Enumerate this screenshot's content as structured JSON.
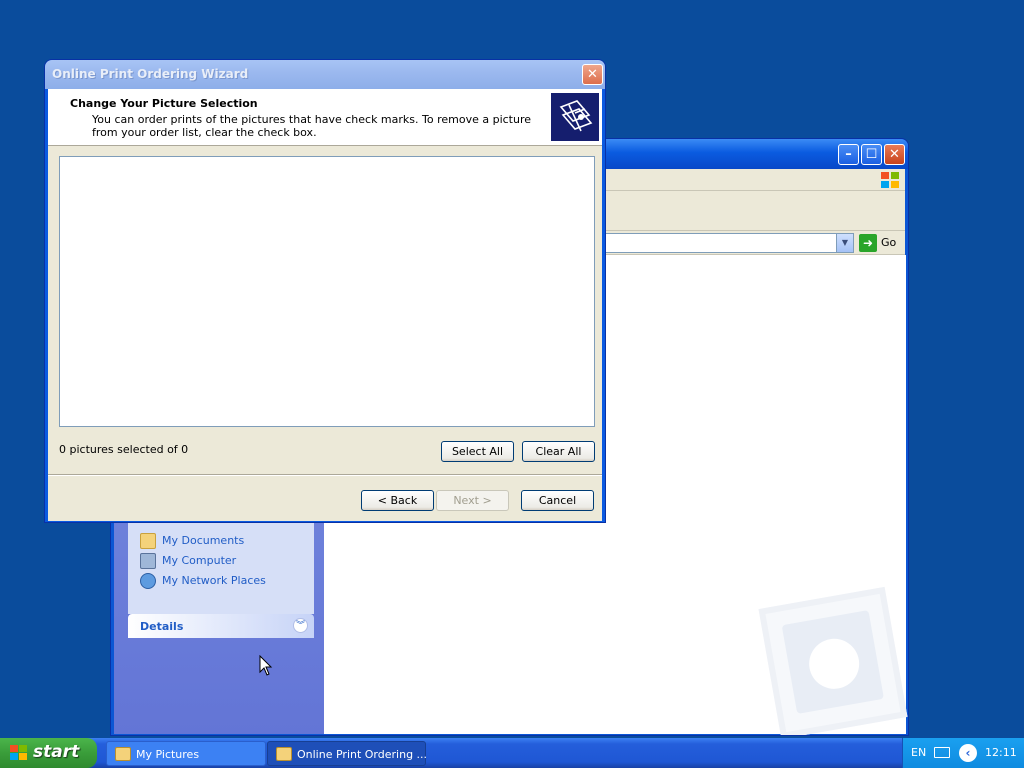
{
  "background_window": {
    "address_go_label": "Go",
    "other_places": [
      {
        "label": "My Documents",
        "icon": "folder-icon"
      },
      {
        "label": "My Computer",
        "icon": "computer-icon"
      },
      {
        "label": "My Network Places",
        "icon": "network-icon"
      }
    ],
    "details_label": "Details"
  },
  "wizard": {
    "title": "Online Print Ordering Wizard",
    "close_glyph": "✕",
    "header_title": "Change Your Picture Selection",
    "header_description": "You can order prints of the pictures that have check marks. To remove a picture from your order list, clear the check box.",
    "selection_count": "0 pictures selected of 0",
    "select_all_label": "Select All",
    "clear_all_label": "Clear All",
    "back_label": "< Back",
    "next_label": "Next >",
    "cancel_label": "Cancel"
  },
  "taskbar": {
    "start_label": "start",
    "tasks": [
      {
        "label": "My Pictures",
        "icon": "pictures-folder-icon",
        "active": false
      },
      {
        "label": "Online Print Ordering ...",
        "icon": "folder-icon",
        "active": true
      }
    ],
    "tray": {
      "language": "EN",
      "clock": "12:11"
    }
  },
  "colors": {
    "desktop": "#0a4c9c",
    "taskbar": "#245edb",
    "start_button": "#3a9d3a",
    "link_blue": "#215dc6"
  }
}
